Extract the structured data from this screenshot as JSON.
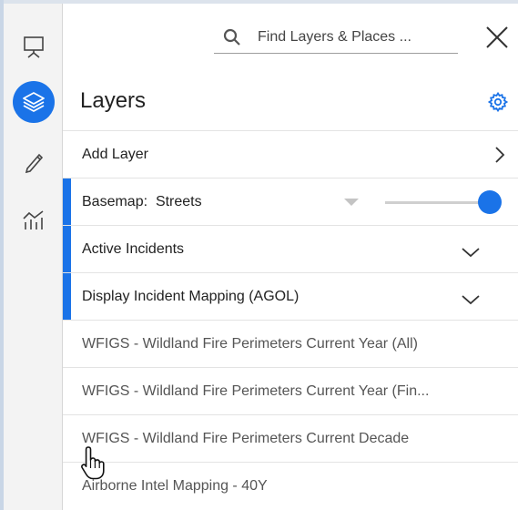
{
  "search": {
    "placeholder": "Find Layers & Places ..."
  },
  "panel": {
    "title": "Layers"
  },
  "rail": {
    "items": [
      "presentation-icon",
      "layers-icon",
      "pencil-icon",
      "chart-icon"
    ],
    "active": 1
  },
  "colors": {
    "accent": "#1a73e8"
  },
  "layers": {
    "add_layer": "Add Layer",
    "basemap_label": "Basemap:",
    "basemap_value": "Streets",
    "basemap_opacity": 1.0,
    "groups": [
      "Active Incidents",
      "Display Incident Mapping (AGOL)"
    ],
    "items": [
      "WFIGS - Wildland Fire Perimeters Current Year (All)",
      "WFIGS - Wildland Fire Perimeters Current Year (Fin...",
      "WFIGS - Wildland Fire Perimeters Current Decade",
      "Airborne Intel Mapping - 40Y"
    ]
  }
}
